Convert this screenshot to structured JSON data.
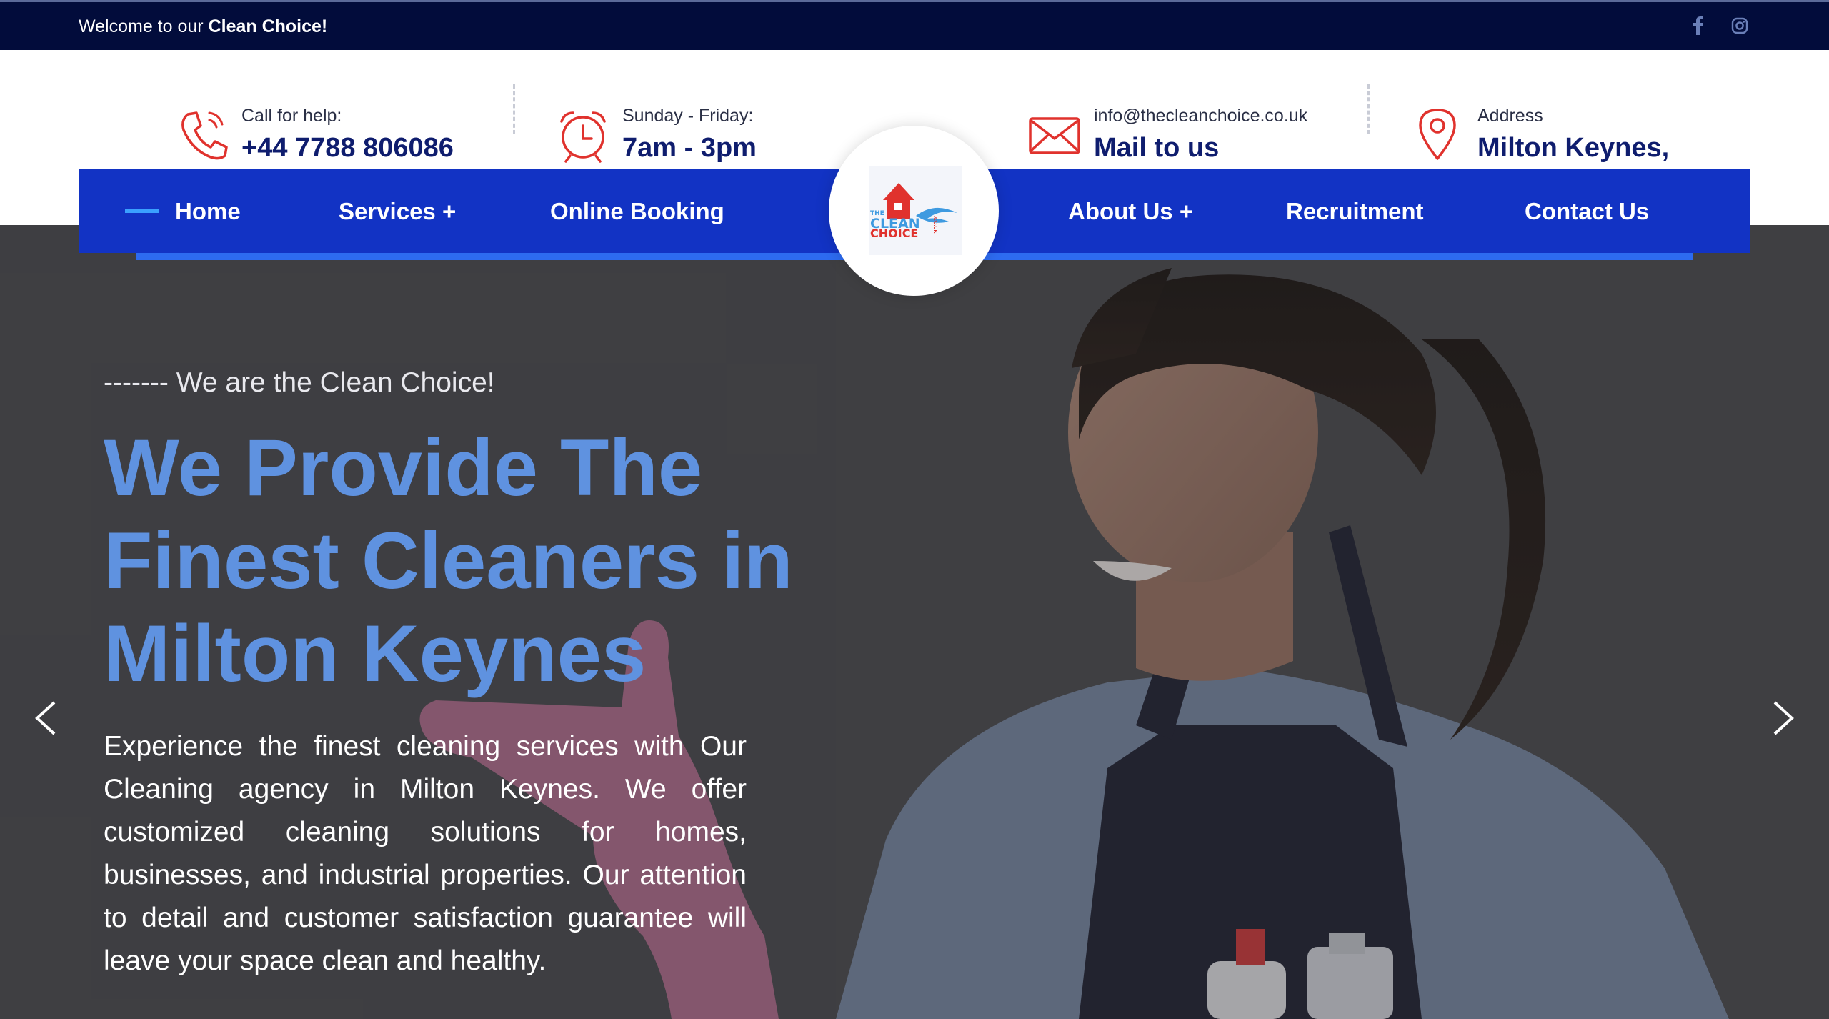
{
  "topbar": {
    "welcome_prefix": "Welcome to our",
    "welcome_brand": "Clean Choice!",
    "social": [
      {
        "icon": "facebook-icon"
      },
      {
        "icon": "instagram-icon"
      }
    ]
  },
  "contact": {
    "call_label": "Call for help:",
    "call_value": "+44 7788 806086",
    "hours_label": "Sunday - Friday:",
    "hours_value": "7am - 3pm",
    "email_label": "info@thecleanchoice.co.uk",
    "email_value": "Mail to us",
    "address_label": "Address",
    "address_value": "Milton Keynes,"
  },
  "nav": {
    "items": [
      {
        "label": "Home"
      },
      {
        "label": "Services +"
      },
      {
        "label": "Online Booking"
      },
      {
        "label": "About Us +"
      },
      {
        "label": "Recruitment"
      },
      {
        "label": "Contact Us"
      }
    ],
    "logo": {
      "line1": "THE",
      "line2": "CLEAN",
      "line3": "CHOICE",
      "side": ".CO.UK"
    }
  },
  "hero": {
    "eyebrow": "------- We are the Clean Choice!",
    "headline": "We Provide The Finest Cleaners in Milton Keynes",
    "description": "Experience the finest cleaning services with Our Cleaning agency in Milton Keynes. We offer customized cleaning solutions for homes, businesses, and industrial properties. Our attention to detail and customer satisfaction guarantee will leave your space clean and healthy."
  },
  "colors": {
    "topbar_bg": "#020c3b",
    "nav_bg": "#1233c4",
    "accent_red": "#e0322d",
    "headline_blue": "#5f92e0",
    "dark_navy": "#0f1d6e"
  }
}
